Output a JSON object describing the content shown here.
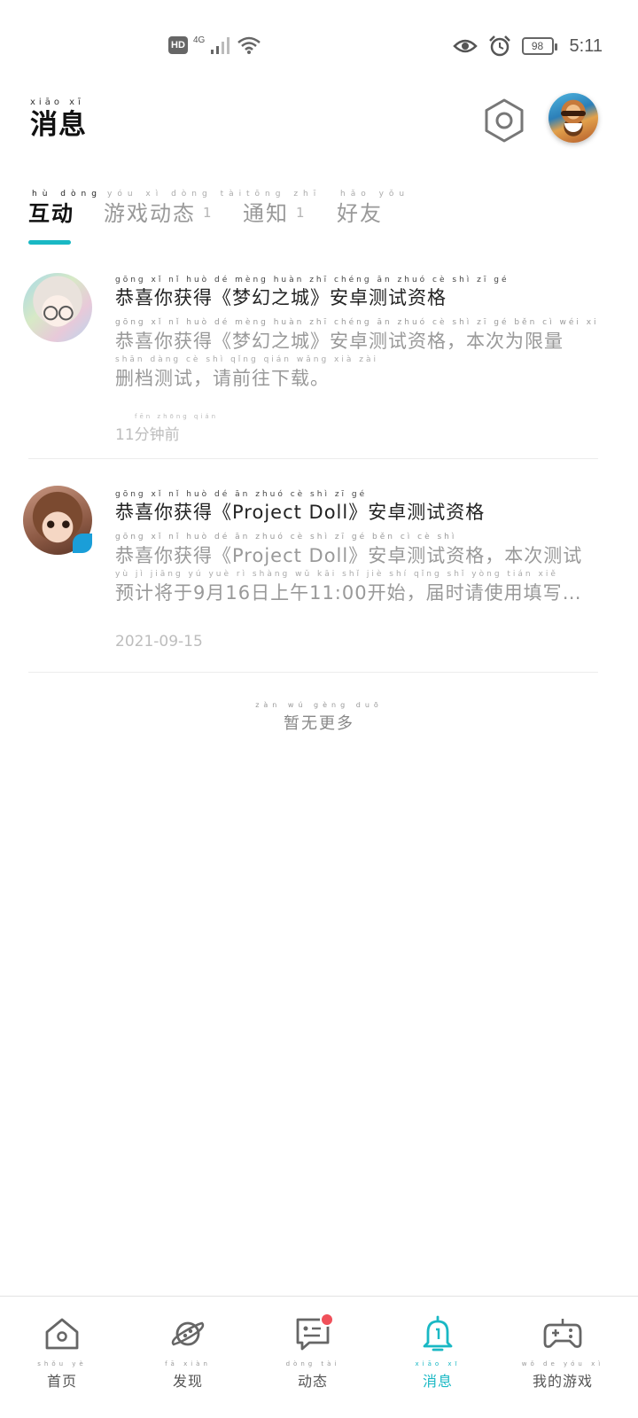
{
  "status_bar": {
    "hd": "HD",
    "network": "4G",
    "battery": "98",
    "time": "5:11"
  },
  "header": {
    "title": "消息",
    "title_pinyin": "xiāo xī"
  },
  "tabs": [
    {
      "label": "互动",
      "pinyin": "hù dòng",
      "count": "",
      "active": true
    },
    {
      "label": "游戏动态",
      "pinyin": "yóu xì dòng tài",
      "count": "1",
      "active": false
    },
    {
      "label": "通知",
      "pinyin": "tōng zhī",
      "count": "1",
      "active": false
    },
    {
      "label": "好友",
      "pinyin": "hǎo yǒu",
      "count": "",
      "active": false
    }
  ],
  "messages": [
    {
      "title": "恭喜你获得《梦幻之城》安卓测试资格",
      "title_pinyin": "gōng xǐ nǐ huò dé   mèng huàn zhī chéng   ān zhuó cè shì zī gé",
      "desc_line1": "恭喜你获得《梦幻之城》安卓测试资格，本次为限量",
      "desc_line1_pinyin": "gōng xǐ nǐ huò dé   mèng huàn zhī chéng   ān zhuó cè shì zī gé   běn cì wéi xiàn liàng",
      "desc_line2": "删档测试，请前往下载。",
      "desc_line2_pinyin": "shān dàng cè shì   qǐng qián wǎng xià zài",
      "time": "11分钟前",
      "time_pinyin": "fēn zhōng qián"
    },
    {
      "title": "恭喜你获得《Project Doll》安卓测试资格",
      "title_pinyin": "gōng xǐ nǐ huò dé                    ān zhuó cè shì zī gé",
      "desc_line1": "恭喜你获得《Project Doll》安卓测试资格，本次测试",
      "desc_line1_pinyin": "gōng xǐ nǐ huò dé                   ān zhuó cè shì zī gé   běn cì cè shì",
      "desc_line2": "预计将于9月16日上午11:00开始，届时请使用填写…",
      "desc_line2_pinyin": "yù jì jiāng yú    yuè    rì shàng wǔ    kāi shǐ   jiè shí qǐng shǐ yòng tián xiě",
      "time": "2021-09-15",
      "time_pinyin": ""
    }
  ],
  "footer": {
    "no_more": "暂无更多",
    "no_more_pinyin": "zàn wú gèng duō"
  },
  "bottom_nav": [
    {
      "label": "首页",
      "pinyin": "shǒu yè",
      "icon": "home-icon"
    },
    {
      "label": "发现",
      "pinyin": "fā xiàn",
      "icon": "planet-icon"
    },
    {
      "label": "动态",
      "pinyin": "dòng tài",
      "icon": "chat-icon",
      "badge": true
    },
    {
      "label": "消息",
      "pinyin": "xiāo xī",
      "icon": "bell-icon",
      "active": true
    },
    {
      "label": "我的游戏",
      "pinyin": "wǒ de yóu xì",
      "icon": "gamepad-icon"
    }
  ],
  "colors": {
    "accent": "#19b8c4",
    "badge": "#f0505a"
  }
}
